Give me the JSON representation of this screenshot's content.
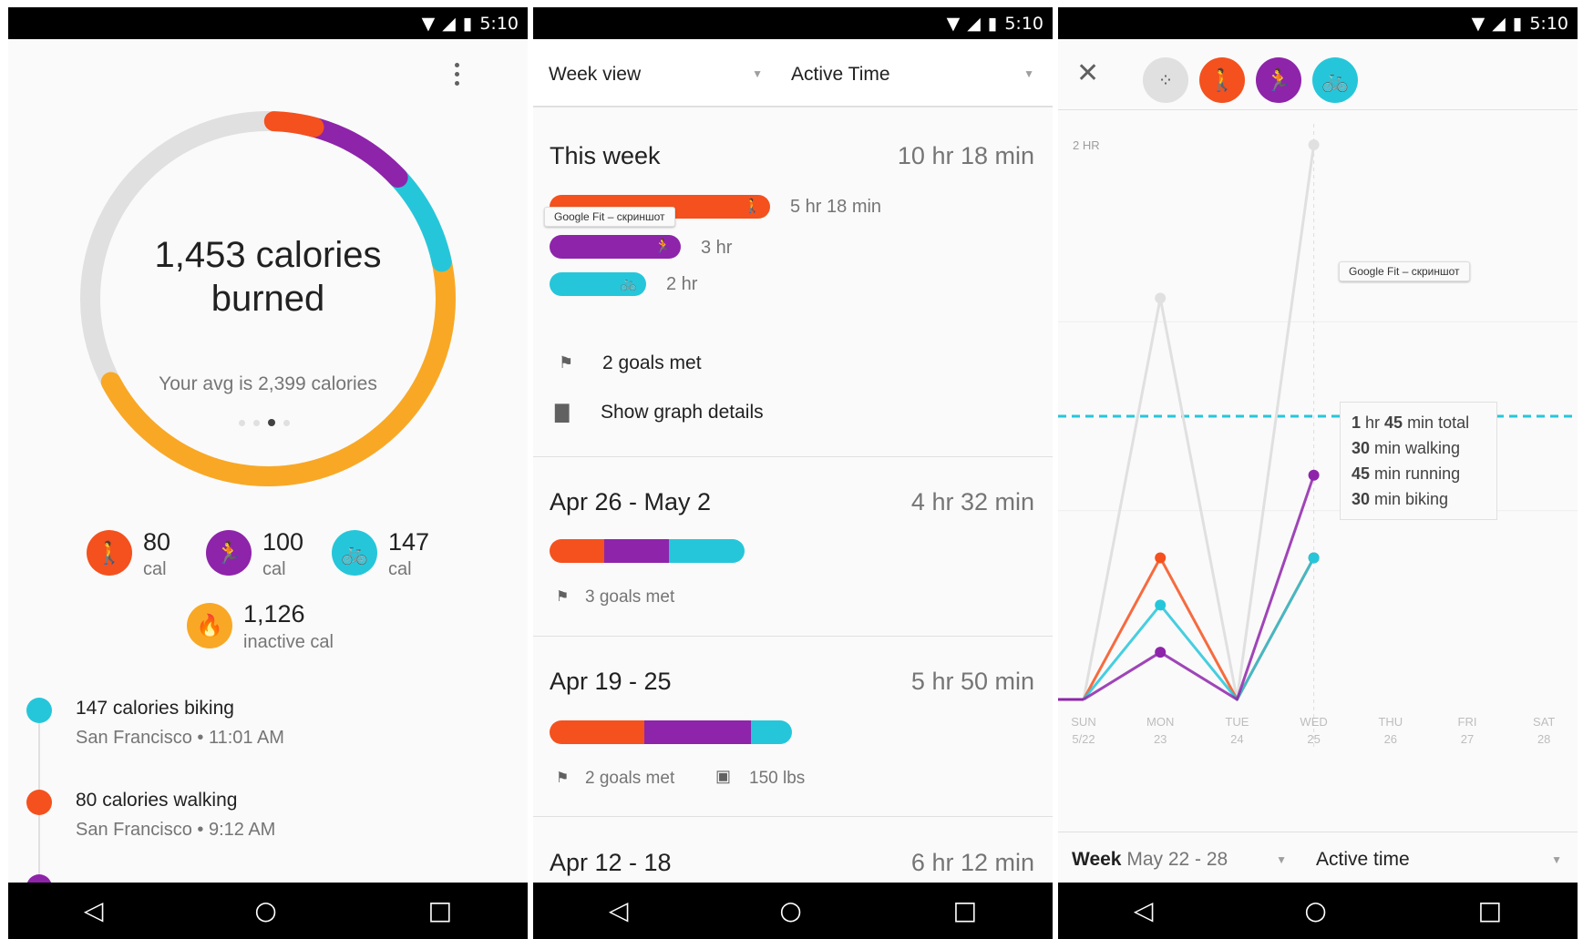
{
  "colors": {
    "walking": "#f4511e",
    "running": "#8e24aa",
    "biking": "#26c6da",
    "inactive": "#f9a825",
    "ring_base": "#e0e0e0"
  },
  "status_bar": {
    "time": "5:10"
  },
  "screen1": {
    "calories_title": "1,453 calories\nburned",
    "avg_text": "Your avg is 2,399 calories",
    "page_dots": 4,
    "active_dot": 3,
    "stats": [
      {
        "icon": "walking-icon",
        "value": "80",
        "unit": "cal"
      },
      {
        "icon": "running-icon",
        "value": "100",
        "unit": "cal"
      },
      {
        "icon": "biking-icon",
        "value": "147",
        "unit": "cal"
      },
      {
        "icon": "flame-icon",
        "value": "1,126",
        "unit": "inactive cal"
      }
    ],
    "timeline": [
      {
        "title": "147 calories biking",
        "subtitle": "San Francisco • 11:01 AM"
      },
      {
        "title": "80 calories walking",
        "subtitle": "San Francisco • 9:12 AM"
      }
    ]
  },
  "screen2": {
    "view_select": "Week view",
    "metric_select": "Active Time",
    "this_week": {
      "title": "This week",
      "total": "10 hr 18 min",
      "bars": [
        {
          "activity": "walking",
          "label": "5 hr 18 min"
        },
        {
          "activity": "running",
          "label": "3 hr"
        },
        {
          "activity": "biking",
          "label": "2 hr"
        }
      ],
      "tooltip": "Google Fit – скриншот",
      "goals": "2 goals met",
      "graph_link": "Show graph details"
    },
    "weeks": [
      {
        "title": "Apr 26 - May 2",
        "total": "4 hr 32 min",
        "segments": [
          0.28,
          0.33,
          0.39
        ],
        "goals": "3 goals met",
        "extra": ""
      },
      {
        "title": "Apr 19 - 25",
        "total": "5 hr 50 min",
        "segments": [
          0.39,
          0.44,
          0.17
        ],
        "goals": "2 goals met",
        "extra": "150 lbs"
      },
      {
        "title": "Apr 12 - 18",
        "total": "6 hr 12 min",
        "segments": [],
        "goals": "",
        "extra": ""
      }
    ]
  },
  "screen3": {
    "close_icon": "close-icon",
    "filters": [
      "all-activities-icon",
      "walking-icon",
      "running-icon",
      "biking-icon"
    ],
    "y_label": "2 HR",
    "tooltip_watermark": "Google Fit – скриншот",
    "summary": [
      {
        "bold": "1",
        "text": " hr ",
        "bold2": "45",
        "text2": " min total"
      },
      {
        "bold": "30",
        "text": " min walking",
        "bold2": "",
        "text2": ""
      },
      {
        "bold": "45",
        "text": " min running",
        "bold2": "",
        "text2": ""
      },
      {
        "bold": "30",
        "text": " min biking",
        "bold2": "",
        "text2": ""
      }
    ],
    "week_label": "Week",
    "week_range": "May 22 - 28",
    "metric_select": "Active time",
    "chart_data": {
      "type": "line",
      "x": [
        "SUN",
        "MON",
        "TUE",
        "WED",
        "THU",
        "FRI",
        "SAT"
      ],
      "x_sub": [
        "5/22",
        "23",
        "24",
        "25",
        "26",
        "27",
        "28"
      ],
      "ylabel": "2 HR",
      "series": [
        {
          "values": [
            0.0,
            1.7,
            0.0,
            2.35
          ]
        },
        {
          "values": [
            0.0,
            0.6,
            0.0,
            0.6
          ]
        },
        {
          "values": [
            0.0,
            0.4,
            0.0,
            0.6
          ]
        },
        {
          "values": [
            0.0,
            0.2,
            0.0,
            0.95
          ]
        }
      ],
      "goal_line": 1.2,
      "ylim": [
        0,
        2.4
      ]
    }
  }
}
